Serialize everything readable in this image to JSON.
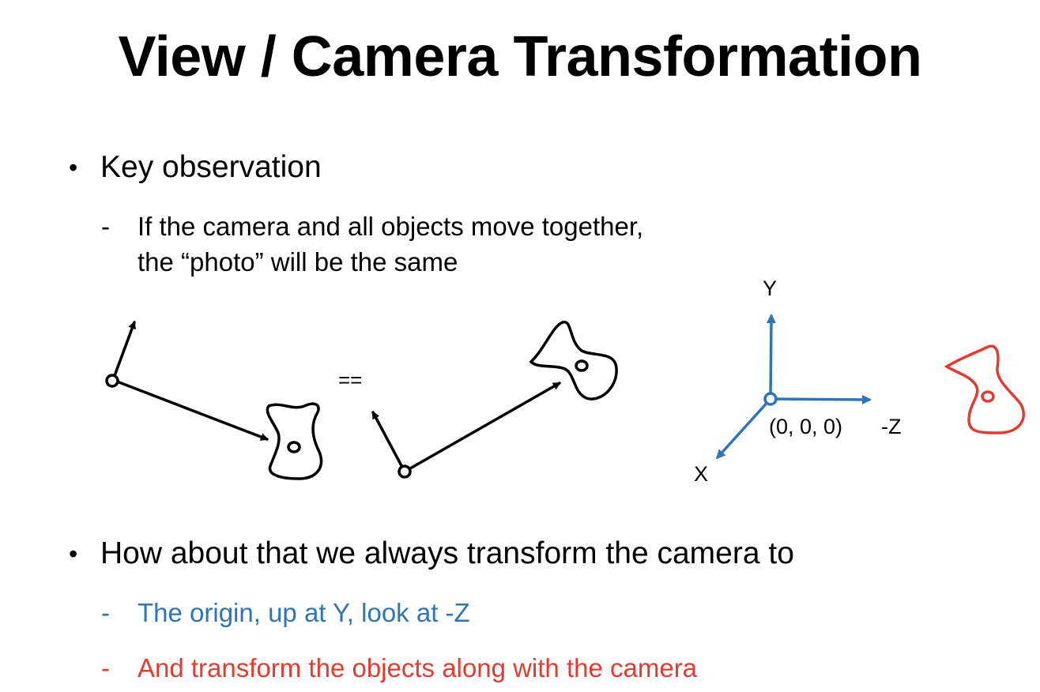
{
  "slide": {
    "title": "View / Camera Transformation",
    "bullets": [
      {
        "text": "Key observation",
        "subs": [
          {
            "line1": "If the camera and all objects move together,",
            "line2": "the “photo” will be the same"
          }
        ]
      },
      {
        "text": "How about that we always transform the camera to",
        "subs": [
          {
            "text": "The origin, up at Y, look at -Z",
            "color": "#2f75b5"
          },
          {
            "text": "And transform the objects along with the camera",
            "color": "#e03c31"
          }
        ]
      }
    ],
    "bullet_symbol": "•",
    "dash_symbol": "-"
  },
  "diagram": {
    "equals": "==",
    "axes": {
      "y": "Y",
      "neg_z": "-Z",
      "x": "X",
      "origin": "(0, 0, 0)"
    },
    "colors": {
      "axes": "#2f75b5",
      "object_red": "#e03c31",
      "sketch": "#000000"
    }
  }
}
